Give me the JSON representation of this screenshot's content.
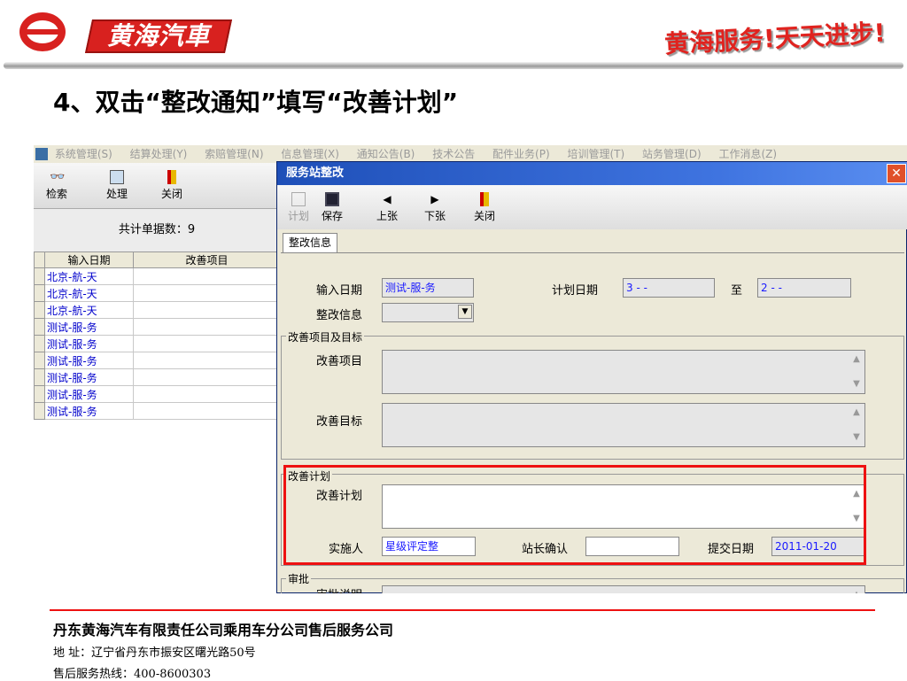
{
  "header": {
    "brand": "黄海汽車",
    "slogan": "黄海服务!天天进步!"
  },
  "heading": "4、双击“整改通知”填写“改善计划”",
  "screenshot": {
    "menu": [
      "系统管理(S)",
      "结算处理(Y)",
      "索赔管理(N)",
      "信息管理(X)",
      "通知公告(B)",
      "技术公告",
      "配件业务(P)",
      "培训管理(T)",
      "站务管理(D)",
      "工作消息(Z)"
    ],
    "left_toolbar": {
      "search": "检索",
      "process": "处理",
      "close": "关闭"
    },
    "total_label": "共计单据数：9",
    "grid": {
      "columns": [
        "输入日期",
        "改善项目"
      ],
      "rows": [
        "北京-航-天",
        "北京-航-天",
        "北京-航-天",
        "测试-服-务",
        "测试-服-务",
        "测试-服-务",
        "测试-服-务",
        "测试-服-务",
        "测试-服-务"
      ]
    },
    "dialog": {
      "title": "服务站整改",
      "toolbar": {
        "plan": "计划",
        "save": "保存",
        "prev": "上张",
        "next": "下张",
        "close": "关闭"
      },
      "tab": "整改信息",
      "input_date_label": "输入日期",
      "input_date_value": "测试-服-务",
      "plan_date_label": "计划日期",
      "plan_date_from": "3  -  -",
      "to_label": "至",
      "plan_date_to": "2  -  -",
      "rectify_info_label": "整改信息",
      "group_items": "改善项目及目标",
      "improve_item_label": "改善项目",
      "improve_target_label": "改善目标",
      "group_plan": "改善计划",
      "improve_plan_label": "改善计划",
      "implementer_label": "实施人",
      "implementer_value": "星级评定整",
      "station_confirm_label": "站长确认",
      "submit_date_label": "提交日期",
      "submit_date_value": "2011-01-20",
      "group_approval": "审批",
      "approval_note_label": "审批说明"
    }
  },
  "footer": {
    "company": "丹东黄海汽车有限责任公司乘用车分公司售后服务公司",
    "address": "地      址：辽宁省丹东市振安区曙光路50号",
    "hotline": "售后服务热线：400-8600303"
  },
  "colors": {
    "brand_red": "#d8211f",
    "highlight": "#ee1111",
    "title_blue": "#1e4fb8"
  }
}
